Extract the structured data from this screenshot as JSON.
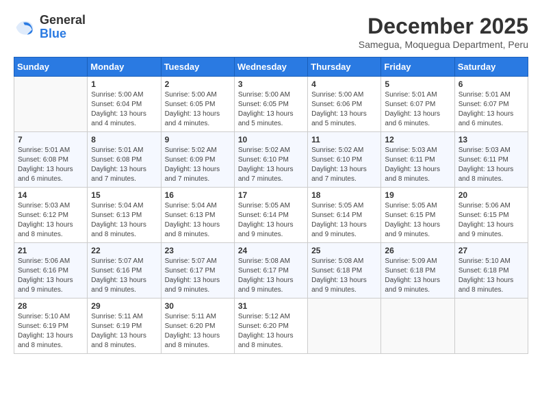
{
  "header": {
    "logo": {
      "general": "General",
      "blue": "Blue"
    },
    "title": "December 2025",
    "subtitle": "Samegua, Moquegua Department, Peru"
  },
  "weekdays": [
    "Sunday",
    "Monday",
    "Tuesday",
    "Wednesday",
    "Thursday",
    "Friday",
    "Saturday"
  ],
  "weeks": [
    [
      {
        "day": null
      },
      {
        "day": 1,
        "sunrise": "5:00 AM",
        "sunset": "6:04 PM",
        "daylight": "13 hours and 4 minutes."
      },
      {
        "day": 2,
        "sunrise": "5:00 AM",
        "sunset": "6:05 PM",
        "daylight": "13 hours and 4 minutes."
      },
      {
        "day": 3,
        "sunrise": "5:00 AM",
        "sunset": "6:05 PM",
        "daylight": "13 hours and 5 minutes."
      },
      {
        "day": 4,
        "sunrise": "5:00 AM",
        "sunset": "6:06 PM",
        "daylight": "13 hours and 5 minutes."
      },
      {
        "day": 5,
        "sunrise": "5:01 AM",
        "sunset": "6:07 PM",
        "daylight": "13 hours and 6 minutes."
      },
      {
        "day": 6,
        "sunrise": "5:01 AM",
        "sunset": "6:07 PM",
        "daylight": "13 hours and 6 minutes."
      }
    ],
    [
      {
        "day": 7,
        "sunrise": "5:01 AM",
        "sunset": "6:08 PM",
        "daylight": "13 hours and 6 minutes."
      },
      {
        "day": 8,
        "sunrise": "5:01 AM",
        "sunset": "6:08 PM",
        "daylight": "13 hours and 7 minutes."
      },
      {
        "day": 9,
        "sunrise": "5:02 AM",
        "sunset": "6:09 PM",
        "daylight": "13 hours and 7 minutes."
      },
      {
        "day": 10,
        "sunrise": "5:02 AM",
        "sunset": "6:10 PM",
        "daylight": "13 hours and 7 minutes."
      },
      {
        "day": 11,
        "sunrise": "5:02 AM",
        "sunset": "6:10 PM",
        "daylight": "13 hours and 7 minutes."
      },
      {
        "day": 12,
        "sunrise": "5:03 AM",
        "sunset": "6:11 PM",
        "daylight": "13 hours and 8 minutes."
      },
      {
        "day": 13,
        "sunrise": "5:03 AM",
        "sunset": "6:11 PM",
        "daylight": "13 hours and 8 minutes."
      }
    ],
    [
      {
        "day": 14,
        "sunrise": "5:03 AM",
        "sunset": "6:12 PM",
        "daylight": "13 hours and 8 minutes."
      },
      {
        "day": 15,
        "sunrise": "5:04 AM",
        "sunset": "6:13 PM",
        "daylight": "13 hours and 8 minutes."
      },
      {
        "day": 16,
        "sunrise": "5:04 AM",
        "sunset": "6:13 PM",
        "daylight": "13 hours and 8 minutes."
      },
      {
        "day": 17,
        "sunrise": "5:05 AM",
        "sunset": "6:14 PM",
        "daylight": "13 hours and 9 minutes."
      },
      {
        "day": 18,
        "sunrise": "5:05 AM",
        "sunset": "6:14 PM",
        "daylight": "13 hours and 9 minutes."
      },
      {
        "day": 19,
        "sunrise": "5:05 AM",
        "sunset": "6:15 PM",
        "daylight": "13 hours and 9 minutes."
      },
      {
        "day": 20,
        "sunrise": "5:06 AM",
        "sunset": "6:15 PM",
        "daylight": "13 hours and 9 minutes."
      }
    ],
    [
      {
        "day": 21,
        "sunrise": "5:06 AM",
        "sunset": "6:16 PM",
        "daylight": "13 hours and 9 minutes."
      },
      {
        "day": 22,
        "sunrise": "5:07 AM",
        "sunset": "6:16 PM",
        "daylight": "13 hours and 9 minutes."
      },
      {
        "day": 23,
        "sunrise": "5:07 AM",
        "sunset": "6:17 PM",
        "daylight": "13 hours and 9 minutes."
      },
      {
        "day": 24,
        "sunrise": "5:08 AM",
        "sunset": "6:17 PM",
        "daylight": "13 hours and 9 minutes."
      },
      {
        "day": 25,
        "sunrise": "5:08 AM",
        "sunset": "6:18 PM",
        "daylight": "13 hours and 9 minutes."
      },
      {
        "day": 26,
        "sunrise": "5:09 AM",
        "sunset": "6:18 PM",
        "daylight": "13 hours and 9 minutes."
      },
      {
        "day": 27,
        "sunrise": "5:10 AM",
        "sunset": "6:18 PM",
        "daylight": "13 hours and 8 minutes."
      }
    ],
    [
      {
        "day": 28,
        "sunrise": "5:10 AM",
        "sunset": "6:19 PM",
        "daylight": "13 hours and 8 minutes."
      },
      {
        "day": 29,
        "sunrise": "5:11 AM",
        "sunset": "6:19 PM",
        "daylight": "13 hours and 8 minutes."
      },
      {
        "day": 30,
        "sunrise": "5:11 AM",
        "sunset": "6:20 PM",
        "daylight": "13 hours and 8 minutes."
      },
      {
        "day": 31,
        "sunrise": "5:12 AM",
        "sunset": "6:20 PM",
        "daylight": "13 hours and 8 minutes."
      },
      {
        "day": null
      },
      {
        "day": null
      },
      {
        "day": null
      }
    ]
  ],
  "labels": {
    "sunrise": "Sunrise:",
    "sunset": "Sunset:",
    "daylight": "Daylight:"
  }
}
